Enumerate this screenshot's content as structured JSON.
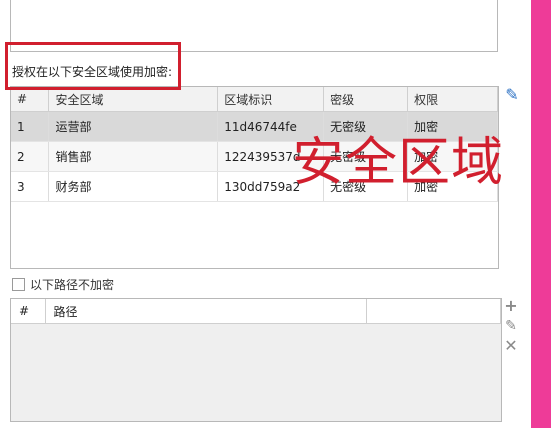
{
  "zones": {
    "label": "授权在以下安全区域使用加密:",
    "columns": [
      "#",
      "安全区域",
      "区域标识",
      "密级",
      "权限"
    ],
    "rows": [
      {
        "num": "1",
        "name": "运营部",
        "id": "11d46744fe",
        "level": "无密级",
        "perm": "加密"
      },
      {
        "num": "2",
        "name": "销售部",
        "id": "122439537d",
        "level": "无密级",
        "perm": "加密"
      },
      {
        "num": "3",
        "name": "财务部",
        "id": "130dd759a2",
        "level": "无密级",
        "perm": "加密"
      }
    ],
    "selected_row": 1
  },
  "overlay": {
    "text": "安全区域",
    "color": "#d11f2e"
  },
  "paths": {
    "checkbox_label": "以下路径不加密",
    "checked": false,
    "columns": [
      "#",
      "路径"
    ]
  },
  "colors": {
    "frame": "#ee3b98",
    "highlight": "#d11f2e",
    "pencil": "#2e72c4"
  },
  "icons": {
    "edit_top": "pencil-icon",
    "add": "plus-icon",
    "edit": "pencil-icon",
    "delete": "x-icon"
  }
}
